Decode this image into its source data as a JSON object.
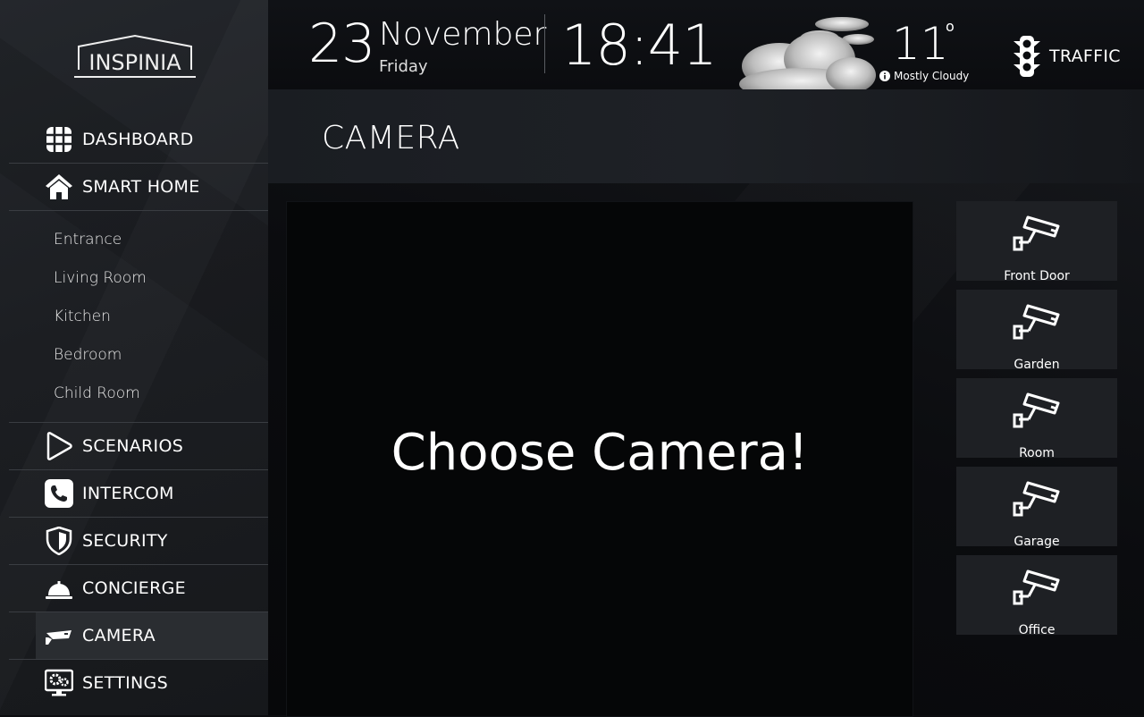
{
  "logo": {
    "text": "INSPINIA"
  },
  "nav": {
    "dashboard": "DASHBOARD",
    "smart_home": "SMART HOME",
    "scenarios": "SCENARIOS",
    "intercom": "INTERCOM",
    "security": "SECURITY",
    "concierge": "CONCIERGE",
    "camera": "CAMERA",
    "settings": "SETTINGS"
  },
  "rooms": [
    "Entrance",
    "Living Room",
    "Kitchen",
    "Bedroom",
    "Child Room"
  ],
  "header": {
    "day": "23",
    "month": "November",
    "weekday": "Friday",
    "time": "18:41",
    "temperature": "11",
    "degree_symbol": "o",
    "condition": "Mostly Cloudy",
    "traffic_label": "TRAFFIC"
  },
  "page": {
    "title": "CAMERA",
    "prompt": "Choose Camera!"
  },
  "cameras": [
    "Front Door",
    "Garden",
    "Room",
    "Garage",
    "Office"
  ],
  "colors": {
    "sidebar_bg": "#1e2024",
    "active_item_bg": "#2a2d31",
    "tile_bg": "#1e2024",
    "text": "#ffffff"
  },
  "icons": {
    "dashboard": "grid-icon",
    "smart_home": "house-icon",
    "scenarios": "play-icon",
    "intercom": "phone-icon",
    "security": "shield-icon",
    "concierge": "service-bell-icon",
    "camera": "security-camera-icon",
    "settings": "settings-monitor-icon",
    "weather": "cloud-icon",
    "traffic": "traffic-light-icon"
  }
}
